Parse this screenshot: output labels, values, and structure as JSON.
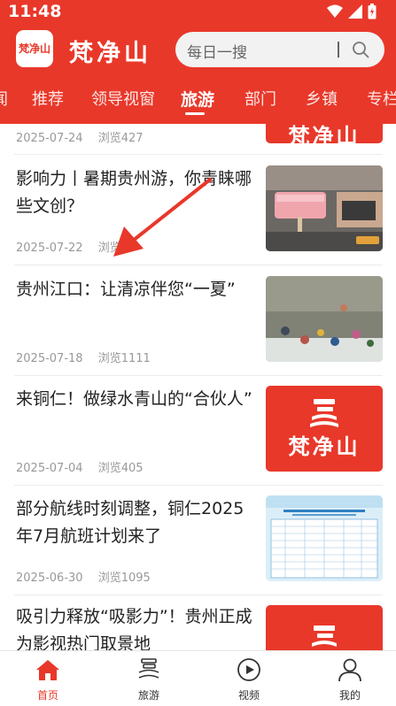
{
  "status_bar": {
    "time": "11:48"
  },
  "app": {
    "brand": "梵净山",
    "logo_mark": "梵净山"
  },
  "search": {
    "placeholder": "每日一搜"
  },
  "tabs": [
    {
      "label": "闻"
    },
    {
      "label": "推荐"
    },
    {
      "label": "领导视窗"
    },
    {
      "label": "旅游",
      "active": true
    },
    {
      "label": "部门"
    },
    {
      "label": "乡镇"
    },
    {
      "label": "专栏"
    }
  ],
  "feed": [
    {
      "title": "",
      "date": "2025-07-24",
      "views": "浏览427",
      "thumb": "梵净山"
    },
    {
      "title": "影响力丨暑期贵州游，你青睐哪些文创？",
      "date": "2025-07-22",
      "views": "浏览4"
    },
    {
      "title": "贵州江口：让清凉伴您“一夏”",
      "date": "2025-07-18",
      "views": "浏览1111"
    },
    {
      "title": "来铜仁！做绿水青山的“合伙人”",
      "date": "2025-07-04",
      "views": "浏览405",
      "thumb": "梵净山"
    },
    {
      "title": "部分航线时刻调整，铜仁2025年7月航班计划来了",
      "date": "2025-06-30",
      "views": "浏览1095"
    },
    {
      "title": "吸引力释放“吸影力”！贵州正成为影视热门取景地",
      "date": "",
      "views": ""
    }
  ],
  "bottom_nav": [
    {
      "label": "首页",
      "icon": "home-icon",
      "active": true
    },
    {
      "label": "旅游",
      "icon": "travel-logo-icon"
    },
    {
      "label": "视频",
      "icon": "play-icon"
    },
    {
      "label": "我的",
      "icon": "user-icon"
    }
  ],
  "colors": {
    "brand_red": "#e8382a",
    "meta_gray": "#999999"
  }
}
